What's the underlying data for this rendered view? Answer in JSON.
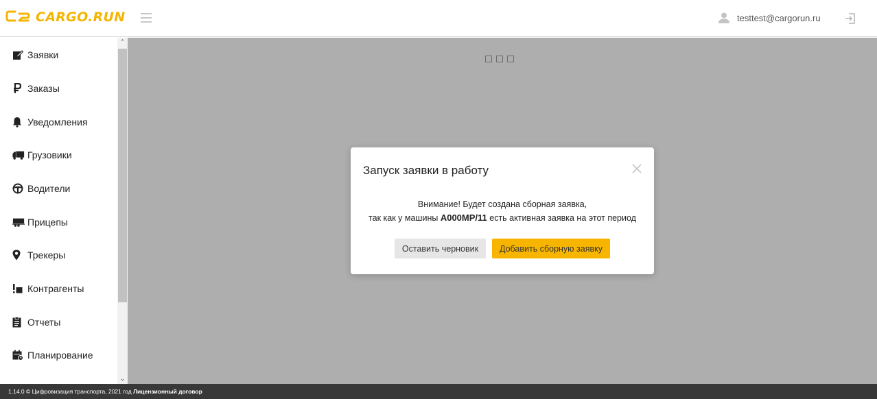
{
  "header": {
    "logo_text": "CARGO.RUN",
    "user_email": "testtest@cargorun.ru",
    "accent_color": "#f5b400"
  },
  "sidebar": {
    "items": [
      {
        "label": "Заявки",
        "icon": "edit-icon"
      },
      {
        "label": "Заказы",
        "icon": "ruble-icon"
      },
      {
        "label": "Уведомления",
        "icon": "bell-icon"
      },
      {
        "label": "Грузовики",
        "icon": "truck-icon"
      },
      {
        "label": "Водители",
        "icon": "steering-wheel-icon"
      },
      {
        "label": "Прицепы",
        "icon": "trailer-icon"
      },
      {
        "label": "Трекеры",
        "icon": "map-marker-icon"
      },
      {
        "label": "Контрагенты",
        "icon": "contractors-icon"
      },
      {
        "label": "Отчеты",
        "icon": "clipboard-icon"
      },
      {
        "label": "Планирование",
        "icon": "calendar-icon"
      }
    ]
  },
  "modal": {
    "title": "Запуск заявки в работу",
    "line1": "Внимание! Будет создана сборная заявка,",
    "line2_prefix": "так как у машины",
    "plate": "А000МР/11",
    "line2_suffix": "есть активная заявка на этот период",
    "btn_draft": "Оставить черновик",
    "btn_add": "Добавить сборную заявку"
  },
  "footer": {
    "text": "1.14.0 © Цифровизация транспорта, 2021 год",
    "license_link": "Лицензионный договор"
  }
}
